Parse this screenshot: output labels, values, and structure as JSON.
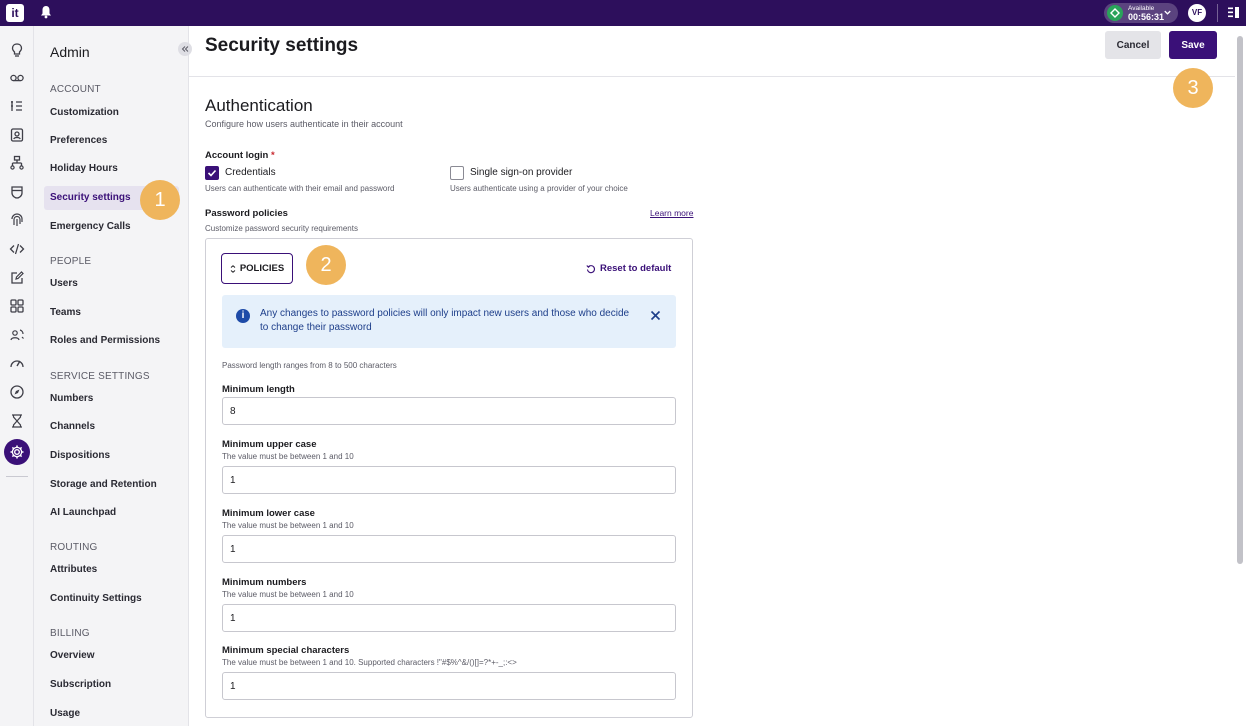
{
  "topbar": {
    "logo_text": "it",
    "status_line1": "Available",
    "status_line2": "00:56:31",
    "avatar_initials": "VF"
  },
  "rail": {
    "icons": [
      "lightbulb-icon",
      "voicemail-icon",
      "list-icon",
      "contacts-icon",
      "workflow-icon",
      "database-icon",
      "fingerprint-icon",
      "code-icon",
      "edit-icon",
      "apps-grid-icon",
      "people-sync-icon",
      "speedometer-icon",
      "compass-icon",
      "hourglass-icon",
      "settings-gear-icon"
    ],
    "active": "settings-gear-icon"
  },
  "sidebar": {
    "title": "Admin",
    "sections": [
      {
        "label": "ACCOUNT",
        "items": [
          "Customization",
          "Preferences",
          "Holiday Hours",
          "Security settings",
          "Emergency Calls"
        ]
      },
      {
        "label": "PEOPLE",
        "items": [
          "Users",
          "Teams",
          "Roles and Permissions"
        ]
      },
      {
        "label": "SERVICE SETTINGS",
        "items": [
          "Numbers",
          "Channels",
          "Dispositions",
          "Storage and Retention",
          "AI Launchpad"
        ]
      },
      {
        "label": "ROUTING",
        "items": [
          "Attributes",
          "Continuity Settings"
        ]
      },
      {
        "label": "BILLING",
        "items": [
          "Overview",
          "Subscription",
          "Usage"
        ]
      }
    ],
    "active_item": "Security settings"
  },
  "header": {
    "title": "Security settings",
    "cancel_label": "Cancel",
    "save_label": "Save"
  },
  "steps": [
    "1",
    "2",
    "3"
  ],
  "auth": {
    "title": "Authentication",
    "subtitle": "Configure how users authenticate in their account",
    "account_login_label": "Account login",
    "required_mark": "*",
    "credentials": {
      "label": "Credentials",
      "help": "Users can authenticate with their email and password",
      "checked": true
    },
    "sso": {
      "label": "Single sign-on provider",
      "help": "Users authenticate using a provider of your choice",
      "checked": false
    }
  },
  "password_policies": {
    "title": "Password policies",
    "subtitle": "Customize password security requirements",
    "learn_more": "Learn more",
    "policies_button": "POLICIES",
    "reset_label": "Reset to default",
    "banner_text": "Any changes to password policies will only impact new users and those who decide to change their password",
    "range_note": "Password length ranges from 8 to 500 characters",
    "fields": {
      "min_length": {
        "label": "Minimum length",
        "value": "8"
      },
      "min_upper": {
        "label": "Minimum upper case",
        "help": "The value must be between 1 and 10",
        "value": "1"
      },
      "min_lower": {
        "label": "Minimum lower case",
        "help": "The value must be between 1 and 10",
        "value": "1"
      },
      "min_numbers": {
        "label": "Minimum numbers",
        "help": "The value must be between 1 and 10",
        "value": "1"
      },
      "min_special": {
        "label": "Minimum special characters",
        "help": "The value must be between 1 and 10. Supported characters !\"#$%^&/()[]=?*+-_;:<>",
        "value": "1"
      }
    }
  },
  "colors": {
    "brand": "#2d0f5c",
    "primary": "#3a1078",
    "step_badge": "#efb55c",
    "banner_bg": "#e5f0fb",
    "status_green": "#29a35a"
  }
}
